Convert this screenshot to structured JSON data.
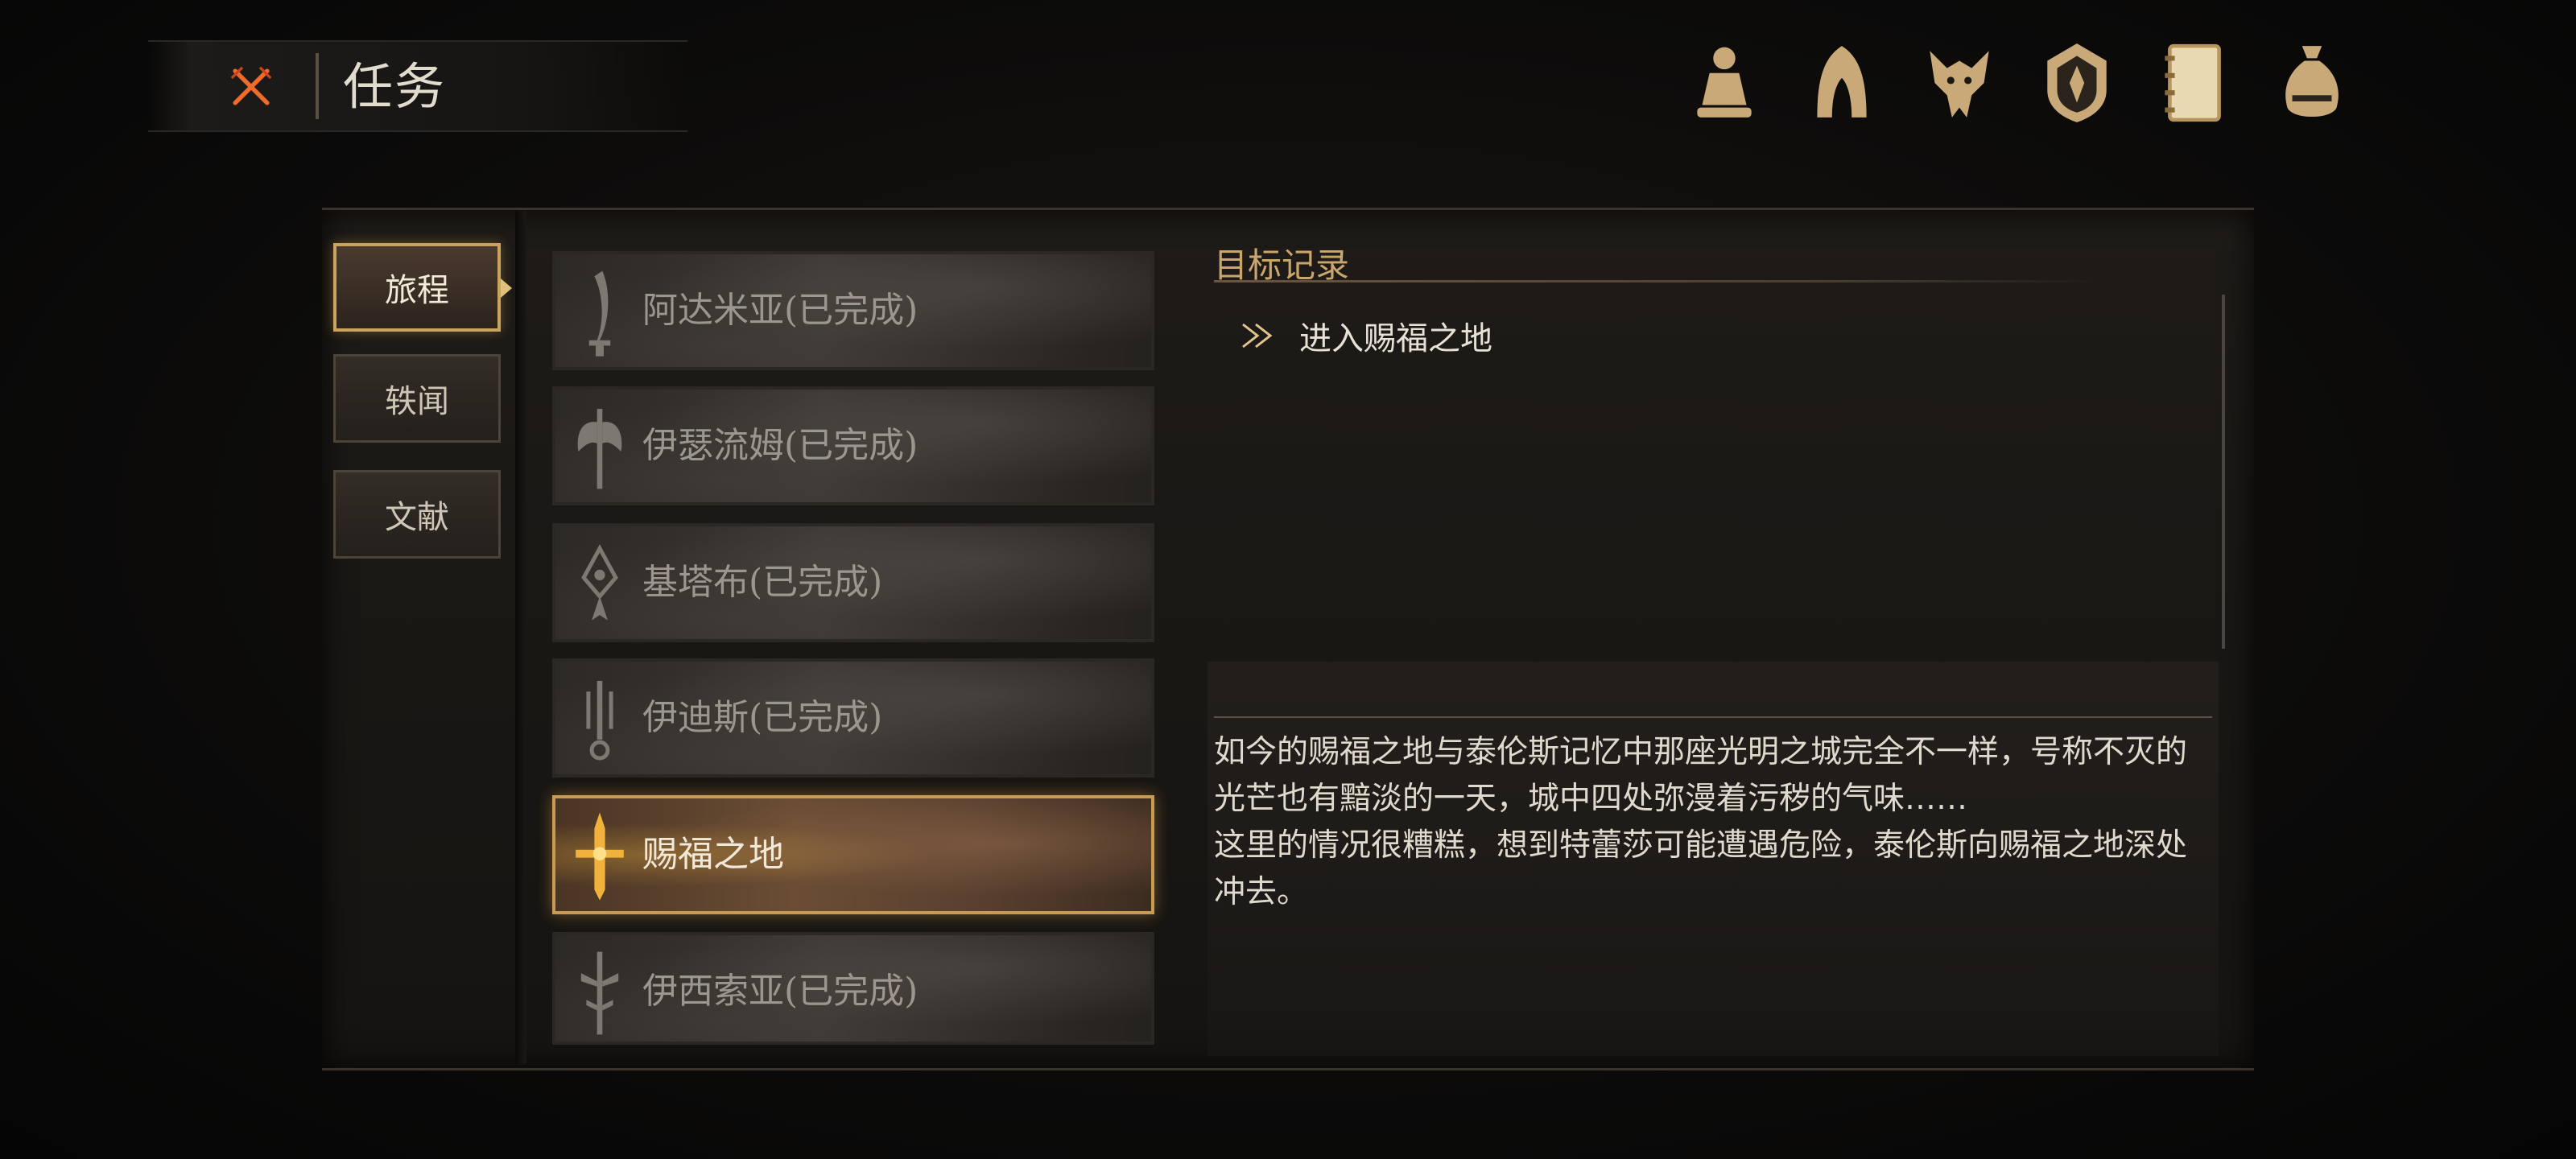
{
  "header": {
    "title": "任务",
    "close_icon": "crossed-swords-close-icon",
    "icons": [
      "character-icon",
      "hood-icon",
      "beast-skull-icon",
      "shield-emblem-icon",
      "journal-icon",
      "coin-bag-icon"
    ]
  },
  "categories": [
    {
      "label": "旅程",
      "active": true
    },
    {
      "label": "轶闻",
      "active": false
    },
    {
      "label": "文献",
      "active": false
    }
  ],
  "quests": [
    {
      "label": "阿达米亚(已完成)",
      "icon": "dagger-icon",
      "active": false
    },
    {
      "label": "伊瑟流姆(已完成)",
      "icon": "winged-axe-icon",
      "active": false
    },
    {
      "label": "基塔布(已完成)",
      "icon": "tribal-mask-icon",
      "active": false
    },
    {
      "label": "伊迪斯(已完成)",
      "icon": "trident-icon",
      "active": false
    },
    {
      "label": "赐福之地",
      "icon": "golden-cross-icon",
      "active": true
    },
    {
      "label": "伊西索亚(已完成)",
      "icon": "sword-emblem-icon",
      "active": false
    }
  ],
  "detail": {
    "section_title": "目标记录",
    "objective": "进入赐福之地",
    "description_lines": [
      "如今的赐福之地与泰伦斯记忆中那座光明之城完全不一样，号称不灭的光芒也有黯淡的一天，城中四处弥漫着污秽的气味……",
      "这里的情况很糟糕，想到特蕾莎可能遭遇危险，泰伦斯向赐福之地深处冲去。"
    ]
  },
  "colors": {
    "accent_gold": "#c9a45e",
    "close_orange": "#e8602a",
    "text_muted": "#9c968e"
  }
}
